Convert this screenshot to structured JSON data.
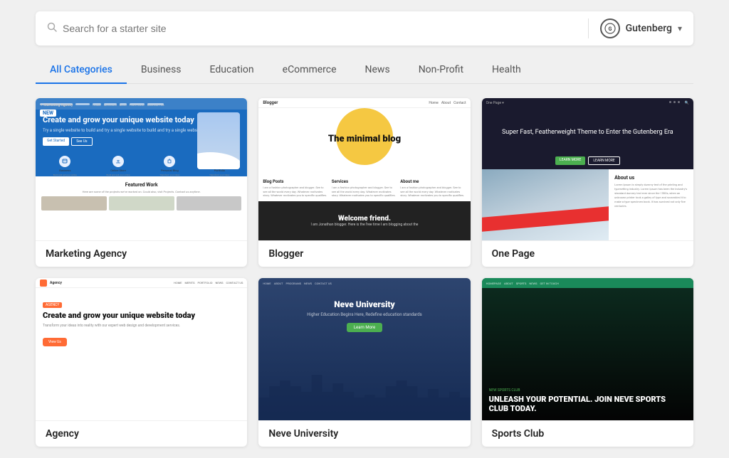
{
  "search": {
    "placeholder": "Search for a starter site"
  },
  "engine": {
    "logo": "G",
    "label": "Gutenberg",
    "arrow": "▾"
  },
  "categories": [
    {
      "id": "all",
      "label": "All Categories",
      "active": true
    },
    {
      "id": "business",
      "label": "Business",
      "active": false
    },
    {
      "id": "education",
      "label": "Education",
      "active": false
    },
    {
      "id": "ecommerce",
      "label": "eCommerce",
      "active": false
    },
    {
      "id": "news",
      "label": "News",
      "active": false
    },
    {
      "id": "nonprofit",
      "label": "Non-Profit",
      "active": false
    },
    {
      "id": "health",
      "label": "Health",
      "active": false
    }
  ],
  "templates": [
    {
      "id": "marketing-agency",
      "name": "Marketing Agency",
      "badge": "NEW",
      "hero_title": "Create and grow your unique website today",
      "hero_sub": "Try a single website to build and try a single website to build and try a single website",
      "btn1": "Get Started",
      "btn2": "See Us",
      "icons": [
        "Business",
        "Online Store",
        "Personal Blog",
        "Portfolio"
      ],
      "featured_title": "Featured Work",
      "featured_sub": "Here are some of the projects we've worked on. Could also, visit Projects. Contact us anytime."
    },
    {
      "id": "blogger",
      "name": "Blogger",
      "hero_title": "The minimal blog",
      "col1_title": "Blog Posts",
      "col2_title": "Services",
      "col3_title": "About me",
      "bottom_text": "Welcome friend.",
      "bottom_sub": "I am Jonathan blogger. Here is the free time I am blogging about the"
    },
    {
      "id": "one-page",
      "name": "One Page",
      "hero_title": "Super Fast, Featherweight Theme to Enter the Gutenberg Era",
      "btn1": "LEARN MORE",
      "btn2": "LEARN MORE",
      "about_title": "About us",
      "about_text": "Lorem Ipsum is simply dummy text of the printing and typesetting industry. Lorem Ipsum has been the industry's standard dummy text ever since the 1500s, when an unknown printer took a galley of type and scrambled it to make a type specimen book. It has survived not only five centuries."
    },
    {
      "id": "agency",
      "name": "Agency",
      "badge_label": "AGENCY",
      "hero_title": "Create and grow your unique website today",
      "hero_sub": "Transform your ideas into reality with our expert web design and development services.",
      "btn_label": "View Us"
    },
    {
      "id": "neve-university",
      "name": "Neve University",
      "hero_title": "Neve University",
      "hero_sub": "Higher Education Begins Here, Redefine education standards",
      "btn_label": "Learn More"
    },
    {
      "id": "sports-club",
      "name": "Sports Club",
      "badge_label": "NEW SPORTS CLUB",
      "hero_title": "UNLEASH YOUR POTENTIAL. JOIN NEVE SPORTS CLUB TODAY."
    }
  ]
}
